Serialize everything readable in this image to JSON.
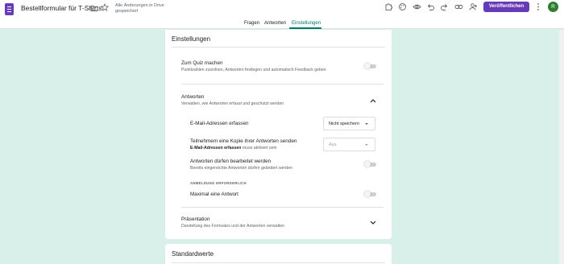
{
  "header": {
    "doc_title": "Bestellformular für T-Shirts",
    "save_status": "Alle Änderungen in Drive gespeichert",
    "publish_label": "Veröffentlichen",
    "avatar_initial": "R",
    "icons": [
      "folder-icon",
      "star-icon",
      "addon-icon",
      "palette-icon",
      "preview-icon",
      "undo-icon",
      "redo-icon",
      "link-icon",
      "add-collaborator-icon",
      "more-vert-icon"
    ]
  },
  "tabs": {
    "items": [
      {
        "label": "Fragen"
      },
      {
        "label": "Antworten"
      },
      {
        "label": "Einstellungen"
      }
    ],
    "active": "Einstellungen"
  },
  "settings": {
    "title": "Einstellungen",
    "quiz": {
      "title": "Zum Quiz machen",
      "subtitle": "Punktzahlen zuordnen, Antworten festlegen und automatisch Feedback geben",
      "enabled": false
    },
    "responses": {
      "title": "Antworten",
      "subtitle": "Verwalten, wie Antworten erfasst und geschützt werden",
      "expanded": true,
      "collect_email": {
        "label": "E-Mail-Adressen erfassen",
        "value": "Nicht speichern"
      },
      "send_copy": {
        "label": "Teilnehmern eine Kopie ihrer Antworten senden",
        "sub_bold": "E-Mail-Adressen erfassen",
        "sub_rest": " muss aktiviert sein",
        "value": "Aus"
      },
      "allow_edit": {
        "label": "Antworten dürfen bearbeitet werden",
        "subtitle": "Bereits eingereichte Antworten dürfen geändert werden",
        "enabled": false
      },
      "login_section_label": "ANMELDUNG ERFORDERLICH",
      "limit_one": {
        "label": "Maximal eine Antwort",
        "enabled": false
      }
    },
    "presentation": {
      "title": "Präsentation",
      "subtitle": "Darstellung des Formulars und der Antworten verwalten",
      "expanded": false
    }
  },
  "defaults": {
    "title": "Standardwerte"
  },
  "colors": {
    "brand": "#673ab7",
    "accent": "#00796b",
    "background": "#d9efe9"
  }
}
